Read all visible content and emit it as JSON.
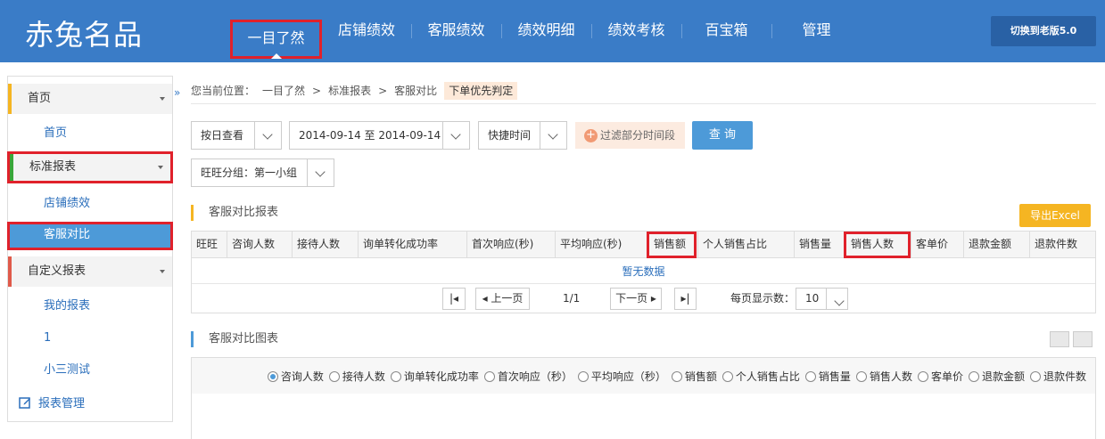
{
  "header": {
    "logo": "赤兔名品",
    "nav": [
      {
        "label": "一目了然",
        "active": true
      },
      {
        "label": "店铺绩效"
      },
      {
        "label": "客服绩效"
      },
      {
        "label": "绩效明细"
      },
      {
        "label": "绩效考核"
      },
      {
        "label": "百宝箱"
      },
      {
        "label": "管理"
      }
    ],
    "switch_label": "切换到老版5.0"
  },
  "sidebar": {
    "groups": [
      {
        "label": "首页",
        "bar_color": "#f5b522",
        "items": [
          "首页"
        ]
      },
      {
        "label": "标准报表",
        "bar_color": "#3aa63a",
        "items": [
          "店铺绩效",
          "客服对比"
        ]
      },
      {
        "label": "自定义报表",
        "bar_color": "#e05a4a",
        "items": [
          "我的报表",
          "1",
          "小三测试"
        ]
      }
    ],
    "manage_label": "报表管理"
  },
  "breadcrumb": {
    "prefix": "您当前位置：",
    "path": [
      "一目了然",
      "标准报表",
      "客服对比"
    ],
    "tag": "下单优先判定"
  },
  "filters": {
    "view_mode": "按日查看",
    "date_range": "2014-09-14 至 2014-09-14",
    "quick_time": "快捷时间",
    "filter_period": "过滤部分时间段",
    "query": "查 询",
    "group": "旺旺分组：第一小组"
  },
  "report": {
    "title": "客服对比报表",
    "export": "导出Excel",
    "columns": [
      "旺旺",
      "咨询人数",
      "接待人数",
      "询单转化成功率",
      "首次响应(秒)",
      "平均响应(秒)",
      "销售额",
      "个人销售占比",
      "销售量",
      "销售人数",
      "客单价",
      "退款金额",
      "退款件数"
    ],
    "empty": "暂无数据",
    "pager": {
      "prev": "上一页",
      "page": "1/1",
      "next": "下一页",
      "per_page_label": "每页显示数：",
      "per_page": "10"
    }
  },
  "chart": {
    "title": "客服对比图表",
    "metrics": [
      "咨询人数",
      "接待人数",
      "询单转化成功率",
      "首次响应（秒）",
      "平均响应（秒）",
      "销售额",
      "个人销售占比",
      "销售量",
      "销售人数",
      "客单价",
      "退款金额",
      "退款件数"
    ],
    "selected_metric": "咨询人数"
  },
  "colors": {
    "header_bg": "#3a7cc7",
    "accent_blue": "#4d9ad8",
    "export_orange": "#f5b522",
    "highlight_red": "#e0212b"
  }
}
